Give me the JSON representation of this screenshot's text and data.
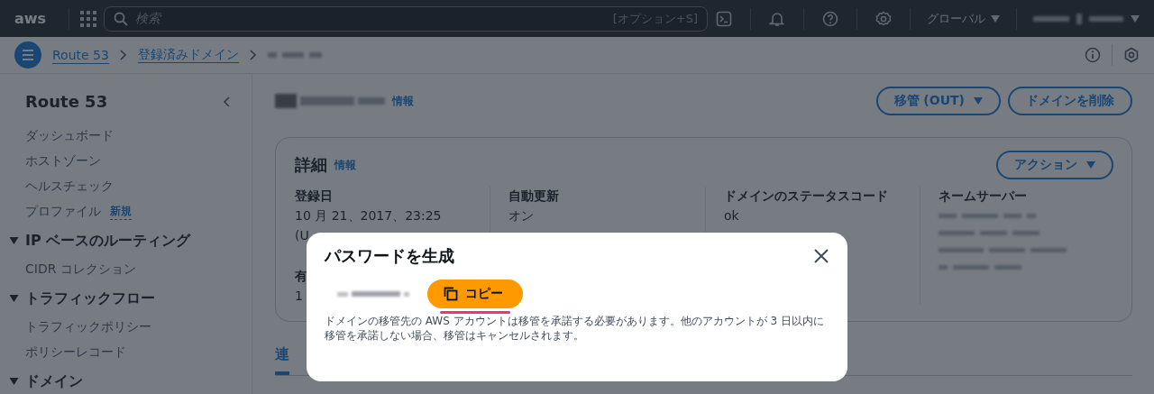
{
  "top_nav": {
    "logo": "aws",
    "search": {
      "placeholder": "検索",
      "shortcut": "[オプション+S]"
    },
    "region": "グローバル"
  },
  "breadcrumb": [
    "Route 53",
    "登録済みドメイン"
  ],
  "sidebar": {
    "title": "Route 53",
    "items": [
      {
        "kind": "link",
        "label": "ダッシュボード"
      },
      {
        "kind": "link",
        "label": "ホストゾーン"
      },
      {
        "kind": "link",
        "label": "ヘルスチェック"
      },
      {
        "kind": "link",
        "label": "プロファイル",
        "badge": "新規"
      },
      {
        "kind": "section",
        "label": "IP ベースのルーティング",
        "expanded": true
      },
      {
        "kind": "link",
        "label": "CIDR コレクション"
      },
      {
        "kind": "section",
        "label": "トラフィックフロー",
        "expanded": true
      },
      {
        "kind": "link",
        "label": "トラフィックポリシー"
      },
      {
        "kind": "link",
        "label": "ポリシーレコード"
      },
      {
        "kind": "section",
        "label": "ドメイン",
        "expanded": true
      }
    ]
  },
  "page_header": {
    "info": "情報",
    "buttons": [
      {
        "label": "移管 (OUT)",
        "dropdown": true
      },
      {
        "label": "ドメインを削除",
        "dropdown": false
      }
    ]
  },
  "details": {
    "title": "詳細",
    "info": "情報",
    "action": "アクション",
    "columns": [
      {
        "fields": [
          {
            "label": "登録日",
            "values": [
              "10 月 21、2017、23:25",
              "(U"
            ]
          },
          {
            "label": "有",
            "values": [
              "1"
            ]
          }
        ]
      },
      {
        "fields": [
          {
            "label": "自動更新",
            "values": [
              "オン"
            ]
          }
        ]
      },
      {
        "fields": [
          {
            "label": "ドメインのステータスコード",
            "values": [
              "ok"
            ]
          }
        ]
      },
      {
        "fields": [
          {
            "label": "ネームサーバー"
          }
        ]
      }
    ]
  },
  "tabs": [
    {
      "label": "連",
      "selected": true
    }
  ],
  "modal": {
    "title": "パスワードを生成",
    "copy_button": {
      "label": "コピー",
      "focused": true
    },
    "message": "ドメインの移管先の AWS アカウントは移管を承諾する必要があります。他のアカウントが 3 日以内に移管を承諾しない場合、移管はキャンセルされます。"
  }
}
